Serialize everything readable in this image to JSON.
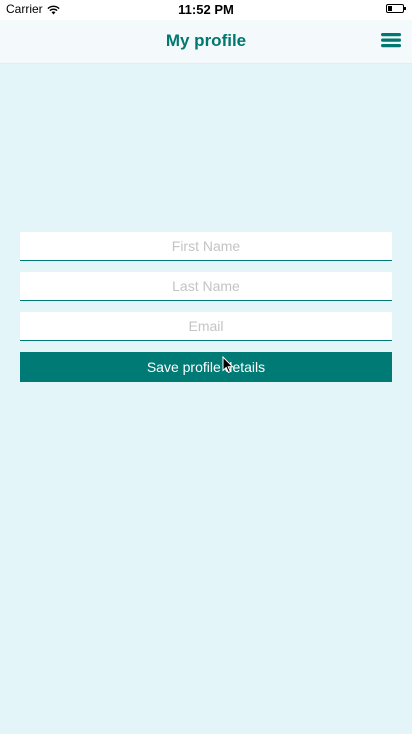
{
  "status_bar": {
    "carrier": "Carrier",
    "time": "11:52 PM",
    "icons": [
      "wifi-icon",
      "battery-icon"
    ]
  },
  "header": {
    "title": "My profile",
    "menu_icon": "hamburger-menu-icon"
  },
  "form": {
    "first_name": {
      "placeholder": "First Name",
      "value": ""
    },
    "last_name": {
      "placeholder": "Last Name",
      "value": ""
    },
    "email": {
      "placeholder": "Email",
      "value": ""
    },
    "save_label": "Save profile details"
  },
  "colors": {
    "accent": "#007a74",
    "background": "#e4f5f9",
    "title": "#00776f"
  }
}
